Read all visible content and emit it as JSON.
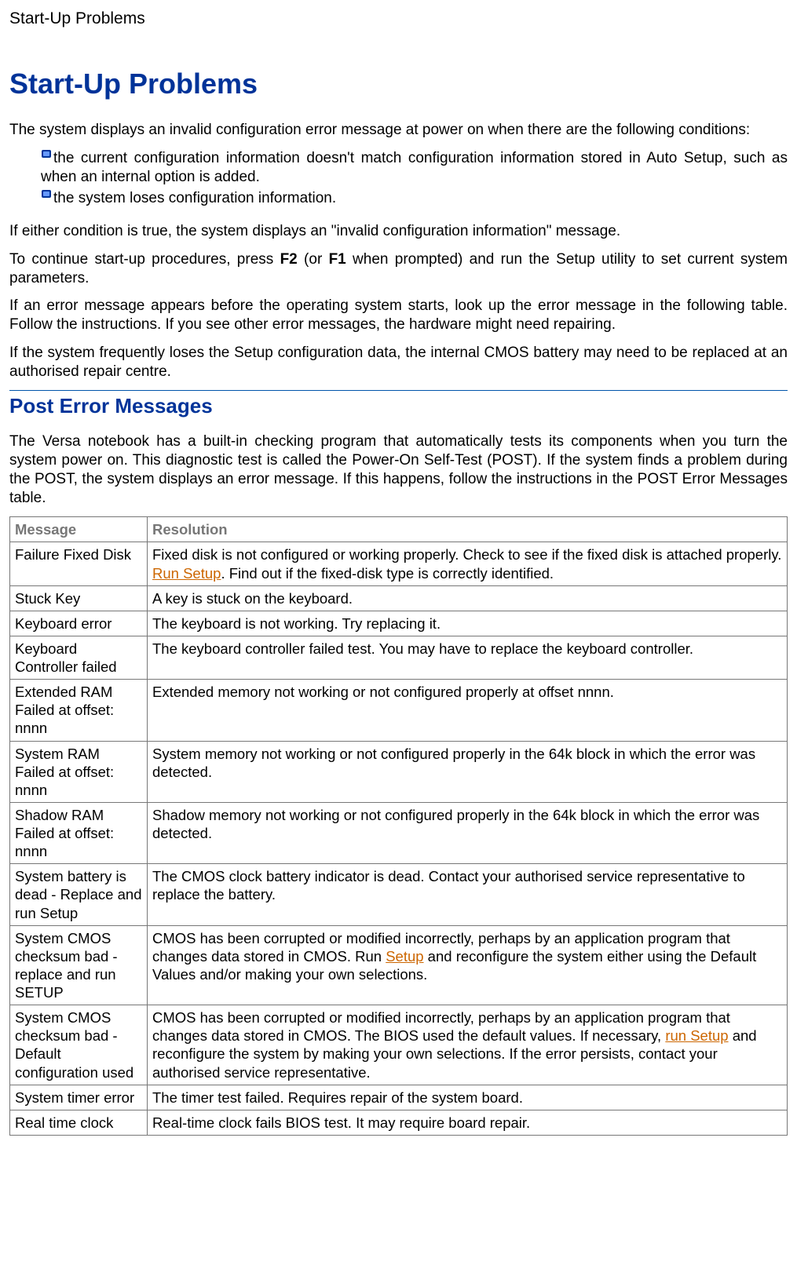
{
  "header": "Start-Up Problems",
  "title": "Start-Up Problems",
  "intro_paras": [
    "The system displays an invalid configuration error message at power on when there are the following conditions:"
  ],
  "bullets": [
    "the current configuration information doesn't match configuration information stored in Auto Setup, such as when an internal option is added.",
    "the system loses configuration information."
  ],
  "paras_after_bullets": {
    "p1": "If either condition is true, the system displays an \"invalid configuration information\" message.",
    "p2_pre": "To continue start-up procedures, press ",
    "p2_key1": "F2",
    "p2_mid": " (or ",
    "p2_key2": "F1",
    "p2_post": " when prompted) and run the Setup utility to set current system parameters.",
    "p3": "If an error message appears before the operating system starts, look up the error message in the following table. Follow the instructions. If you see other error messages, the hardware might need repairing.",
    "p4": "If the system frequently loses the Setup configuration data, the internal CMOS battery may need to be replaced at an authorised repair centre."
  },
  "subsection_title": "Post Error Messages",
  "subsection_para": "The Versa notebook has a built-in checking program that automatically tests its components when you turn the system power on. This diagnostic test is called the Power-On Self-Test (POST). If the system finds a problem during the POST, the system displays an error message. If this happens, follow the instructions in the POST Error Messages table.",
  "table": {
    "headers": {
      "message": "Message",
      "resolution": "Resolution"
    },
    "rows": [
      {
        "message": "Failure Fixed Disk",
        "res_pre": "Fixed disk is not configured or working properly. Check to see if the fixed disk is attached properly. ",
        "res_link": "Run Setup",
        "res_post": ". Find out if the fixed-disk type is correctly identified."
      },
      {
        "message": "Stuck Key",
        "res_pre": "A key is stuck on the keyboard.",
        "res_link": "",
        "res_post": ""
      },
      {
        "message": "Keyboard error",
        "res_pre": "The keyboard is not working. Try replacing it.",
        "res_link": "",
        "res_post": ""
      },
      {
        "message": "Keyboard Controller failed",
        "res_pre": "The keyboard controller failed test. You may have to replace the keyboard controller.",
        "res_link": "",
        "res_post": ""
      },
      {
        "message": "Extended RAM Failed at offset: nnnn",
        "res_pre": "Extended memory not working or not configured properly at offset nnnn.",
        "res_link": "",
        "res_post": ""
      },
      {
        "message": "System RAM Failed at offset: nnnn",
        "res_pre": "System memory not working or not configured properly in the 64k block in which the error was detected.",
        "res_link": "",
        "res_post": ""
      },
      {
        "message": "Shadow RAM Failed at offset: nnnn",
        "res_pre": "Shadow memory not working or not configured properly in the 64k block in which the error was detected.",
        "res_link": "",
        "res_post": ""
      },
      {
        "message": "System battery is dead - Replace and run Setup",
        "res_pre": "The CMOS clock battery indicator is dead. Contact your authorised service representative to replace the battery.",
        "res_link": "",
        "res_post": ""
      },
      {
        "message": "System CMOS checksum bad - replace and run SETUP",
        "res_pre": "CMOS has been corrupted or modified incorrectly, perhaps by an application program that changes data stored in CMOS. Run ",
        "res_link": "Setup",
        "res_post": " and reconfigure the system either using the Default Values and/or making your own selections."
      },
      {
        "message": "System CMOS checksum bad - Default configuration used",
        "res_pre": "CMOS has been corrupted or modified incorrectly, perhaps by an application program that changes data stored in CMOS. The BIOS used the default values. If necessary, ",
        "res_link": "run Setup",
        "res_post": " and reconfigure the system by making your own selections. If the error persists, contact your authorised service representative."
      },
      {
        "message": "System timer error",
        "res_pre": "The timer test failed. Requires repair of the system board.",
        "res_link": "",
        "res_post": ""
      },
      {
        "message": "Real time clock",
        "res_pre": "Real-time clock fails BIOS test. It may require board repair.",
        "res_link": "",
        "res_post": ""
      }
    ]
  }
}
